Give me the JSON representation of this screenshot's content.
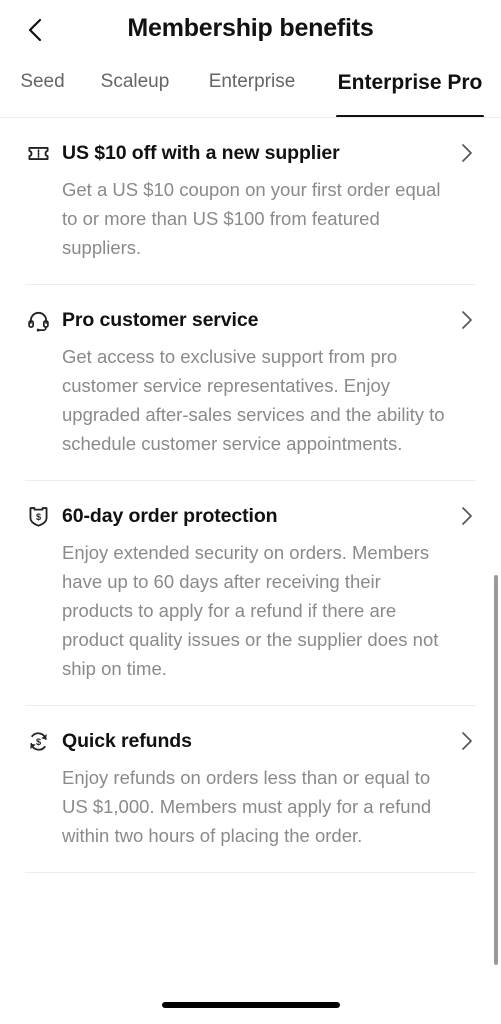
{
  "header": {
    "back_icon": "chevron-left-icon",
    "title": "Membership benefits"
  },
  "tabs": [
    {
      "label": "Seed",
      "active": false
    },
    {
      "label": "Scaleup",
      "active": false
    },
    {
      "label": "Enterprise",
      "active": false
    },
    {
      "label": "Enterprise Pro",
      "active": true
    }
  ],
  "benefits": [
    {
      "icon": "coupon-ticket-icon",
      "title": "US $10 off with a new supplier",
      "description": "Get a US $10 coupon on your first order equal to or more than US $100 from featured suppliers.",
      "chevron": "chevron-right-icon"
    },
    {
      "icon": "headset-icon",
      "title": "Pro customer service",
      "description": "Get access to exclusive support from pro customer service representatives. Enjoy upgraded after-sales services and the ability to schedule customer service appointments.",
      "chevron": "chevron-right-icon"
    },
    {
      "icon": "shield-dollar-icon",
      "title": "60-day order protection",
      "description": "Enjoy extended security on orders. Members have up to 60 days after receiving their products to apply for a refund if there are product quality issues or the supplier does not ship on time.",
      "chevron": "chevron-right-icon"
    },
    {
      "icon": "refresh-dollar-icon",
      "title": "Quick refunds",
      "description": "Enjoy refunds on orders less than or equal to US $1,000. Members must apply for a refund within two hours of placing the order.",
      "chevron": "chevron-right-icon"
    }
  ],
  "colors": {
    "background": "#ffffff",
    "title_text": "#111111",
    "body_text": "#8a8a8a",
    "inactive_tab": "#666666",
    "divider": "#ededed",
    "active_indicator": "#111111",
    "scrollbar": "#9a9a9a",
    "home_indicator": "#000000"
  }
}
